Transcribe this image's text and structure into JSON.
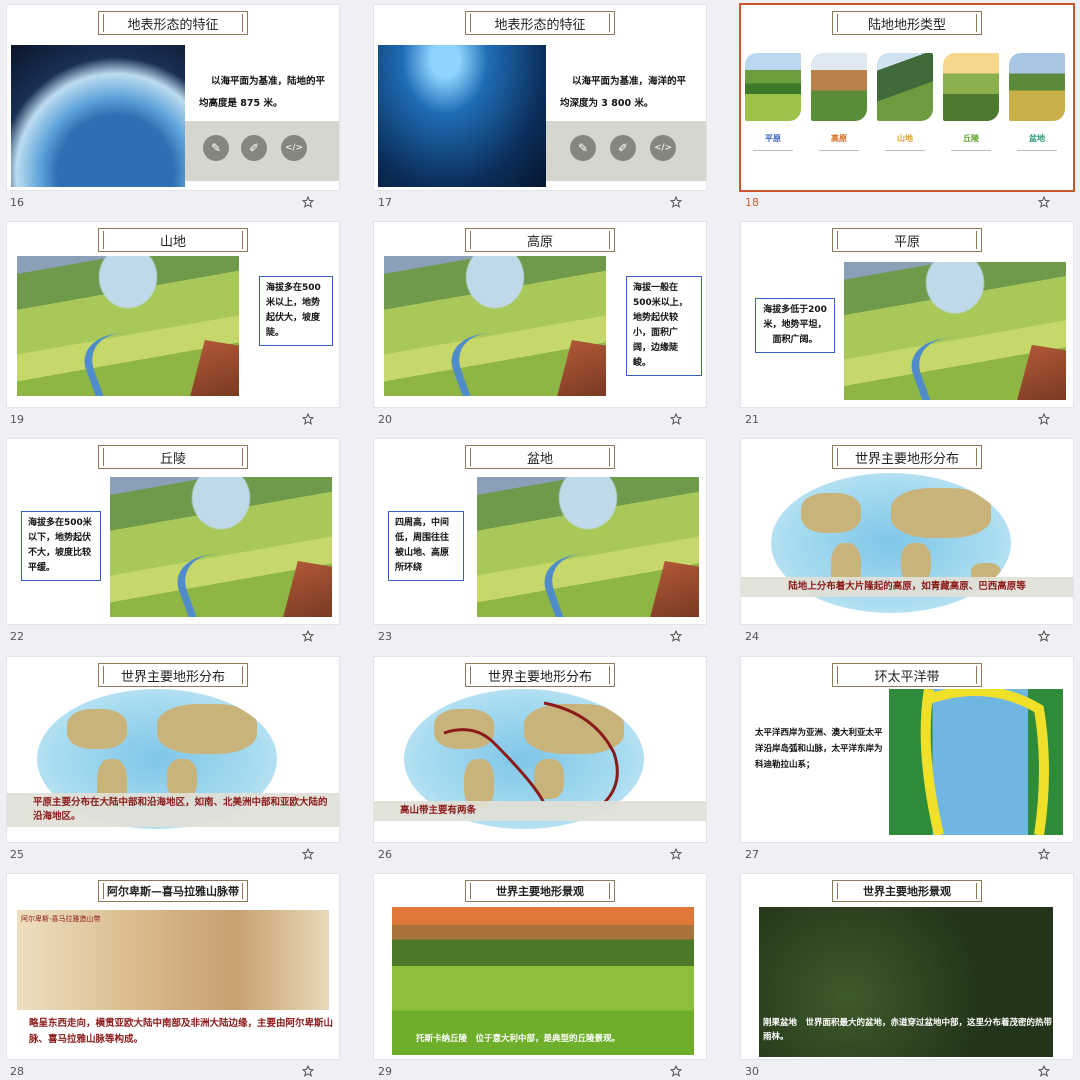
{
  "slides": [
    {
      "num": "16",
      "title": "地表形态的特征",
      "text_lines": [
        "以海平面为基准，陆地的平",
        "均高度是 875 米。"
      ],
      "selected": false
    },
    {
      "num": "17",
      "title": "地表形态的特征",
      "text_lines": [
        "以海平面为基准，海洋的平",
        "均深度为 3 800 米。"
      ],
      "selected": false
    },
    {
      "num": "18",
      "title": "陆地地形类型",
      "labels": [
        "平原",
        "高原",
        "山地",
        "丘陵",
        "盆地"
      ],
      "label_colors": [
        "#3a5fbf",
        "#d2691e",
        "#e0a020",
        "#5aa02c",
        "#2a9a7a"
      ],
      "selected": true
    },
    {
      "num": "19",
      "title": "山地",
      "callout": "海拔多在500米以上，地势起伏大，坡度陡。"
    },
    {
      "num": "20",
      "title": "高原",
      "callout": "海拔一般在500米以上，地势起伏较小，面积广阔，边缘陡峻。"
    },
    {
      "num": "21",
      "title": "平原",
      "callout": "海拔多低于200米，地势平坦，面积广阔。"
    },
    {
      "num": "22",
      "title": "丘陵",
      "callout": "海拔多在500米以下，地势起伏不大，坡度比较平缓。"
    },
    {
      "num": "23",
      "title": "盆地",
      "callout": "四周高，中间低，周围往往被山地、高原所环绕"
    },
    {
      "num": "24",
      "title": "世界主要地形分布",
      "band": "陆地上分布着大片隆起的高原，如青藏高原、巴西高原等"
    },
    {
      "num": "25",
      "title": "世界主要地形分布",
      "band": "平原主要分布在大陆中部和沿海地区，如南、北美洲中部和亚欧大陆的沿海地区。"
    },
    {
      "num": "26",
      "title": "世界主要地形分布",
      "band": "高山带主要有两条"
    },
    {
      "num": "27",
      "title": "环太平洋带",
      "text": "太平洋西岸为亚洲、澳大利亚太平洋沿岸岛弧和山脉，太平洋东岸为科迪勒拉山系；"
    },
    {
      "num": "28",
      "title": "阿尔卑斯—喜马拉雅山脉带",
      "map_title": "阿尔卑斯-喜马拉雅造山带",
      "caption": "略呈东西走向，横贯亚欧大陆中南部及非洲大陆边缘，主要由阿尔卑斯山脉、喜马拉雅山脉等构成。"
    },
    {
      "num": "29",
      "title": "世界主要地形景观",
      "caption": "托斯卡纳丘陵　位于意大利中部，是典型的丘陵景观。"
    },
    {
      "num": "30",
      "title": "世界主要地形景观",
      "caption": "刚果盆地　世界面积最大的盆地，赤道穿过盆地中部，这里分布着茂密的热带雨林。"
    }
  ],
  "colors": {
    "accent": "#c8582b",
    "caption_red": "#8b1a1a",
    "callout_border": "#3a5fbf"
  },
  "icons": {
    "buttons": [
      "pencil-circle-icon",
      "edit-icon",
      "code-icon"
    ],
    "star": "star-outline-icon"
  }
}
